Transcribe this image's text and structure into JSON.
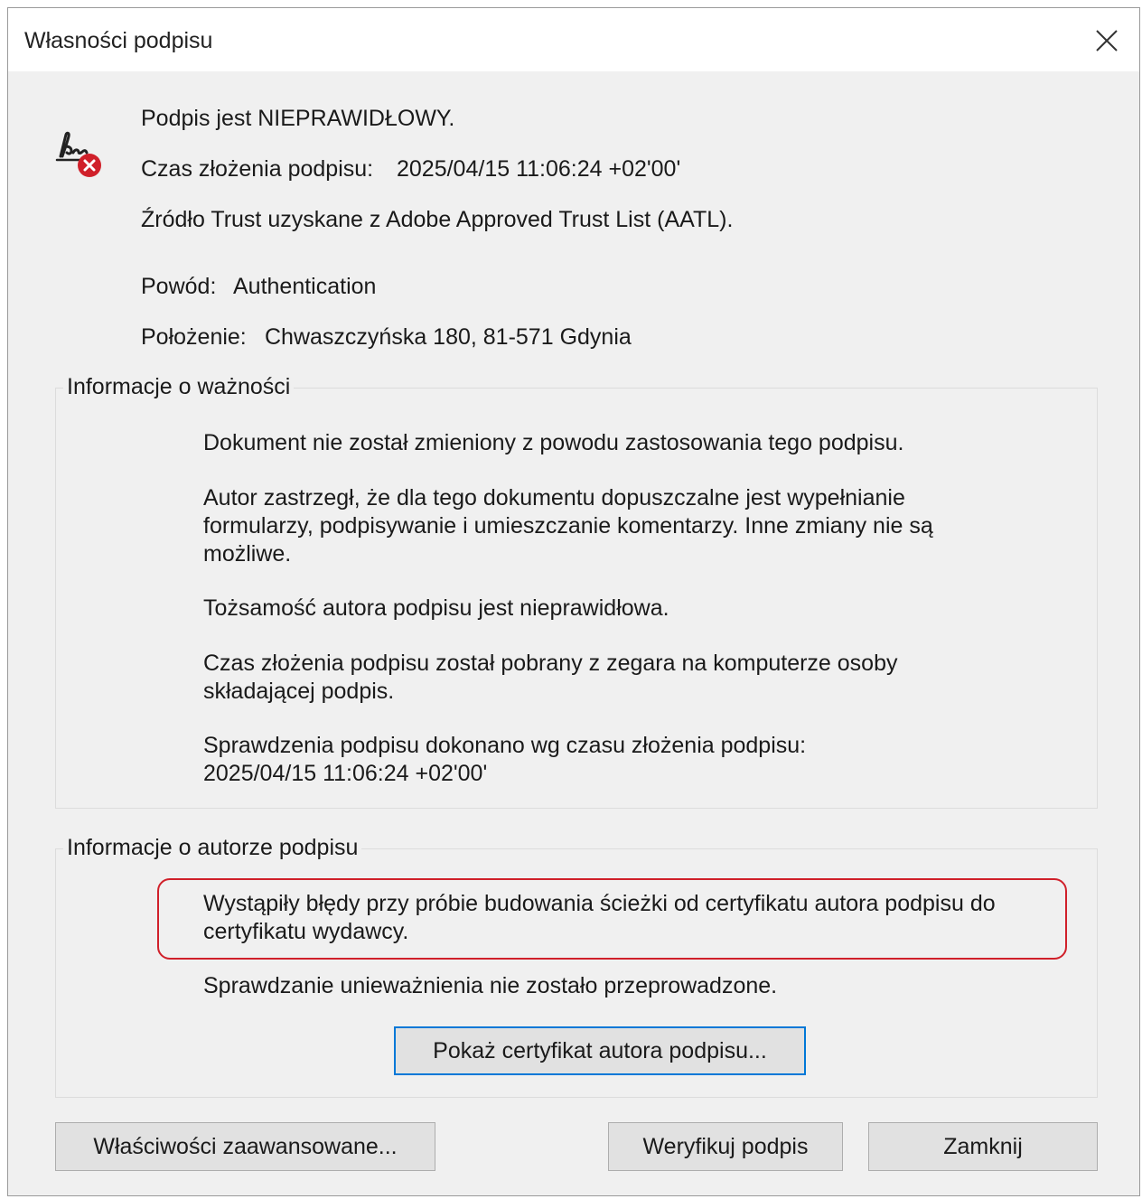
{
  "window": {
    "title": "Własności podpisu",
    "close_icon": "close-icon"
  },
  "summary": {
    "status_icon": "invalid-signature-icon",
    "status": "Podpis jest NIEPRAWIDŁOWY.",
    "signing_time_label": "Czas złożenia podpisu:",
    "signing_time_value": "2025/04/15 11:06:24 +02'00'",
    "trust_source": "Źródło Trust uzyskane z Adobe Approved Trust List (AATL).",
    "reason_label": "Powód:",
    "reason_value": "Authentication",
    "location_label": "Położenie:",
    "location_value": "Chwaszczyńska 180, 81-571 Gdynia"
  },
  "validity": {
    "title": "Informacje o ważności",
    "paragraphs": [
      "Dokument nie został zmieniony z powodu zastosowania tego podpisu.",
      "Autor zastrzegł, że dla tego dokumentu dopuszczalne jest wypełnianie formularzy, podpisywanie i umieszczanie komentarzy. Inne zmiany nie są możliwe.",
      "Tożsamość autora podpisu jest nieprawidłowa.",
      "Czas złożenia podpisu został pobrany z zegara na komputerze osoby składającej podpis.",
      "Sprawdzenia podpisu dokonano wg czasu złożenia podpisu: 2025/04/15 11:06:24 +02'00'"
    ]
  },
  "author": {
    "title": "Informacje o autorze podpisu",
    "error": "Wystąpiły błędy przy próbie budowania ścieżki od certyfikatu autora podpisu do certyfikatu wydawcy.",
    "revocation": "Sprawdzanie unieważnienia nie zostało przeprowadzone.",
    "show_cert_button": "Pokaż certyfikat autora podpisu..."
  },
  "footer": {
    "advanced_button": "Właściwości zaawansowane...",
    "verify_button": "Weryfikuj podpis",
    "close_button": "Zamknij"
  },
  "colors": {
    "error_red": "#d0202a",
    "focus_blue": "#0078d7",
    "dialog_bg": "#f0f0f0"
  }
}
